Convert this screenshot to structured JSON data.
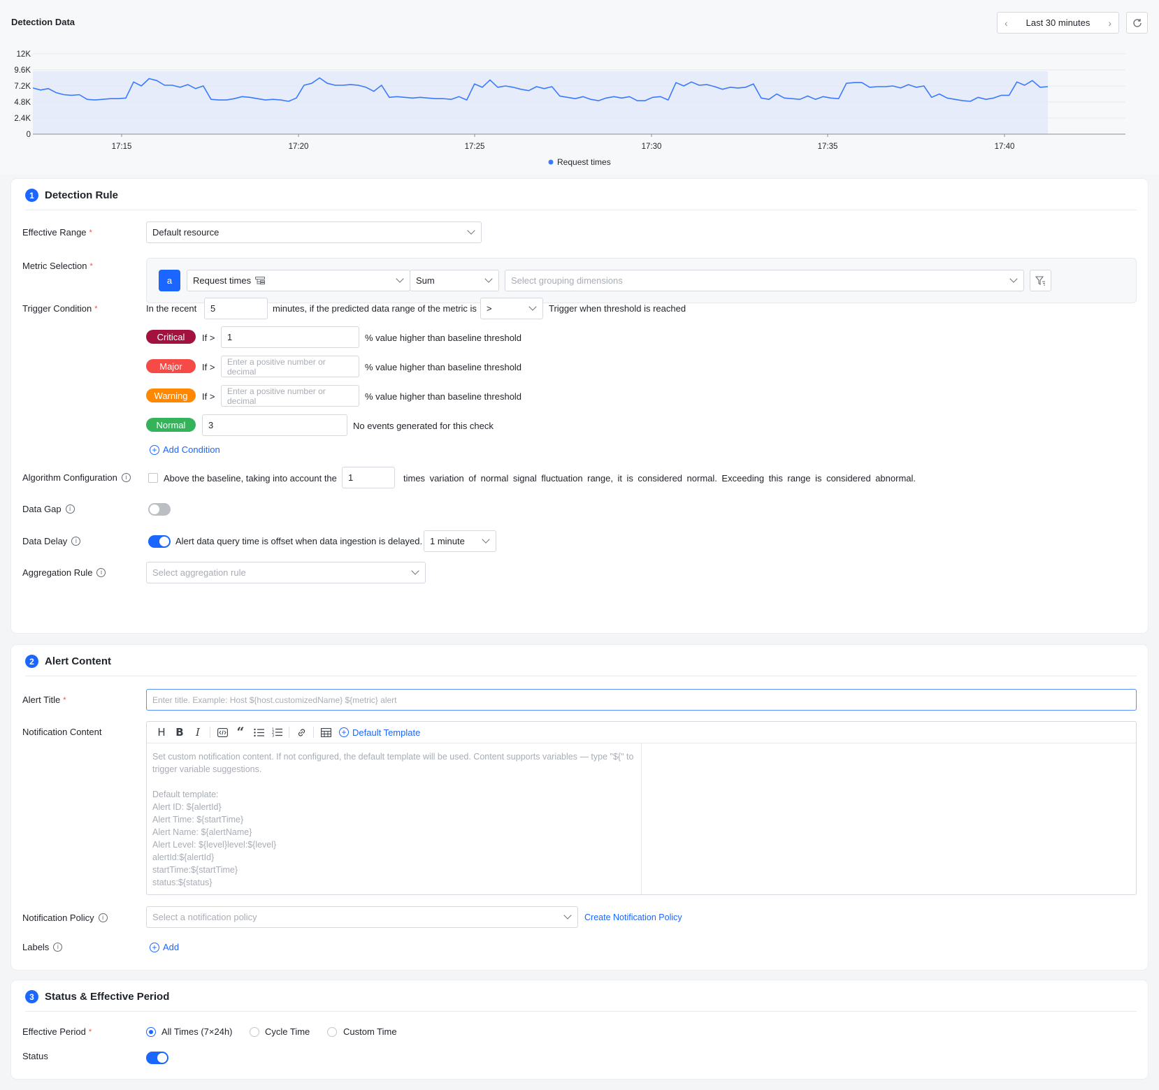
{
  "header": {
    "title": "Detection Data",
    "time_range": "Last 30 minutes"
  },
  "chart_data": {
    "type": "area",
    "legend": "Request times",
    "legend_position": "bottom-center",
    "y_ticks": [
      "0",
      "2.4K",
      "4.8K",
      "7.2K",
      "9.6K",
      "12K"
    ],
    "ylim": [
      0,
      12000
    ],
    "x_ticks": [
      "17:15",
      "17:20",
      "17:25",
      "17:30",
      "17:35",
      "17:40"
    ],
    "baseline_band": [
      0,
      9400
    ],
    "series": [
      {
        "values": [
          6900,
          6600,
          6800,
          6200,
          5900,
          5800,
          5900,
          5200,
          5100,
          5200,
          5300,
          5300,
          5400,
          7800,
          7200,
          8300,
          8000,
          7300,
          7300,
          7000,
          7400,
          6800,
          7200,
          5200,
          5100,
          5100,
          5300,
          5600,
          5500,
          5300,
          5100,
          5200,
          5100,
          4900,
          5400,
          7300,
          7600,
          8400,
          7600,
          7300,
          7300,
          7400,
          7300,
          7000,
          6400,
          7300,
          5500,
          5600,
          5500,
          5400,
          5500,
          5400,
          5300,
          5300,
          5200,
          5600,
          5100,
          7500,
          7000,
          8100,
          7000,
          7200,
          7000,
          6700,
          6500,
          7100,
          6800,
          7100,
          5700,
          5500,
          5300,
          5600,
          5200,
          5000,
          5400,
          5600,
          5400,
          5600,
          5000,
          5000,
          5500,
          5600,
          5100,
          7700,
          7200,
          7800,
          7300,
          7400,
          7100,
          6700,
          7000,
          6900,
          7000,
          7500,
          5400,
          5200,
          6000,
          5400,
          5300,
          5200,
          5700,
          5200,
          5600,
          5400,
          5300,
          7600,
          7700,
          7700,
          7000,
          7100,
          7100,
          7200,
          6900,
          7400,
          7000,
          7200,
          5500,
          6000,
          5400,
          5200,
          5000,
          4900,
          5500,
          5200,
          5400,
          5800,
          5800,
          7800,
          7300,
          8000,
          7000,
          7100
        ]
      }
    ]
  },
  "detection_rule": {
    "step": "1",
    "title": "Detection Rule",
    "effective_range": {
      "label": "Effective Range",
      "value": "Default resource"
    },
    "metric_selection": {
      "label": "Metric Selection",
      "alias": "a",
      "metric": "Request times",
      "aggregation": "Sum",
      "grouping_placeholder": "Select grouping dimensions"
    },
    "trigger": {
      "label": "Trigger Condition",
      "prefix": "In the recent",
      "minutes": "5",
      "middle": "minutes, if the predicted data range of the metric is",
      "operator": ">",
      "suffix": "Trigger when threshold is reached",
      "if_label": "If >",
      "higher_text": "% value higher than baseline threshold",
      "placeholder": "Enter a positive number or decimal",
      "critical": {
        "label": "Critical",
        "value": "1",
        "color": "#a3123e"
      },
      "major": {
        "label": "Major",
        "color": "#f54a45"
      },
      "warning": {
        "label": "Warning",
        "color": "#ff8800"
      },
      "normal": {
        "label": "Normal",
        "value": "3",
        "text": "No events generated for this check",
        "color": "#34b35a"
      },
      "add_condition": "Add Condition"
    },
    "algorithm": {
      "label": "Algorithm Configuration",
      "text_before": "Above the baseline, taking into account the",
      "value": "1",
      "text_after": "times variation of normal signal fluctuation range, it is considered normal. Exceeding this range is considered abnormal."
    },
    "data_gap": {
      "label": "Data Gap",
      "enabled": false
    },
    "data_delay": {
      "label": "Data Delay",
      "enabled": true,
      "text": "Alert data query time is offset when data ingestion is delayed.",
      "value": "1 minute"
    },
    "aggregation_rule": {
      "label": "Aggregation Rule",
      "placeholder": "Select aggregation rule"
    }
  },
  "alert_content": {
    "step": "2",
    "title": "Alert Content",
    "alert_title": {
      "label": "Alert Title",
      "placeholder": "Enter title. Example: Host ${host.customizedName} ${metric} alert"
    },
    "notification_content": {
      "label": "Notification Content",
      "default_template": "Default Template",
      "placeholder": "Set custom notification content. If not configured, the default template will be used. Content supports variables — type \"${\" to trigger variable suggestions.\n\nDefault template:\nAlert ID: ${alertId}\nAlert Time: ${startTime}\nAlert Name: ${alertName}\nAlert Level: ${level}level:${level}\nalertId:${alertId}\nstartTime:${startTime}\nstatus:${status}"
    },
    "notification_policy": {
      "label": "Notification Policy",
      "placeholder": "Select a notification policy",
      "create_link": "Create Notification Policy"
    },
    "labels": {
      "label": "Labels",
      "add": "Add"
    }
  },
  "status_period": {
    "step": "3",
    "title": "Status & Effective Period",
    "effective_period": {
      "label": "Effective Period",
      "options": [
        "All Times (7×24h)",
        "Cycle Time",
        "Custom Time"
      ],
      "selected": "All Times (7×24h)"
    },
    "status": {
      "label": "Status",
      "enabled": true
    }
  },
  "colors": {
    "accent": "#1a66ff",
    "line": "#3a7afe",
    "band": "#e6ecf9"
  }
}
